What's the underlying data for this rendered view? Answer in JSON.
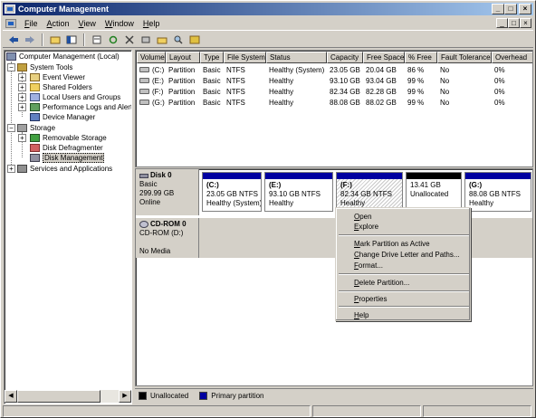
{
  "window": {
    "title": "Computer Management",
    "controls": [
      "_",
      "□",
      "×"
    ]
  },
  "menu": {
    "items": [
      {
        "mnemonic": "F",
        "rest": "ile"
      },
      {
        "mnemonic": "A",
        "rest": "ction"
      },
      {
        "mnemonic": "V",
        "rest": "iew"
      },
      {
        "mnemonic": "W",
        "rest": "indow"
      },
      {
        "mnemonic": "H",
        "rest": "elp"
      }
    ],
    "mdi_controls": [
      "_",
      "□",
      "×"
    ]
  },
  "toolbar": {
    "icons": [
      "back-icon",
      "forward-icon",
      "up-folder-icon",
      "show-hide-tree-icon",
      "properties-icon",
      "refresh-icon",
      "delete-icon",
      "settings-icon",
      "open-icon",
      "search-icon",
      "help-icon"
    ]
  },
  "tree": {
    "root": "Computer Management (Local)",
    "system_tools": "System Tools",
    "event_viewer": "Event Viewer",
    "shared_folders": "Shared Folders",
    "local_users": "Local Users and Groups",
    "perf_logs": "Performance Logs and Alerts",
    "device_manager": "Device Manager",
    "storage": "Storage",
    "removable_storage": "Removable Storage",
    "disk_defrag": "Disk Defragmenter",
    "disk_management": "Disk Management",
    "services_apps": "Services and Applications"
  },
  "volume_list": {
    "headers": [
      "Volume",
      "Layout",
      "Type",
      "File System",
      "Status",
      "Capacity",
      "Free Space",
      "% Free",
      "Fault Tolerance",
      "Overhead"
    ],
    "rows": [
      [
        "(C:)",
        "Partition",
        "Basic",
        "NTFS",
        "Healthy (System)",
        "23.05 GB",
        "20.04 GB",
        "86 %",
        "No",
        "0%"
      ],
      [
        "(E:)",
        "Partition",
        "Basic",
        "NTFS",
        "Healthy",
        "93.10 GB",
        "93.04 GB",
        "99 %",
        "No",
        "0%"
      ],
      [
        "(F:)",
        "Partition",
        "Basic",
        "NTFS",
        "Healthy",
        "82.34 GB",
        "82.28 GB",
        "99 %",
        "No",
        "0%"
      ],
      [
        "(G:)",
        "Partition",
        "Basic",
        "NTFS",
        "Healthy",
        "88.08 GB",
        "88.02 GB",
        "99 %",
        "No",
        "0%"
      ]
    ]
  },
  "disks": {
    "disk0": {
      "name": "Disk 0",
      "type": "Basic",
      "size": "299.99 GB",
      "status": "Online",
      "partitions": [
        {
          "name": "(C:)",
          "detail": "23.05 GB NTFS",
          "status": "Healthy (System)"
        },
        {
          "name": "(E:)",
          "detail": "93.10 GB NTFS",
          "status": "Healthy"
        },
        {
          "name": "(F:)",
          "detail": "82.34 GB NTFS",
          "status": "Healthy"
        },
        {
          "name": "",
          "detail": "13.41 GB",
          "status": "Unallocated"
        },
        {
          "name": "(G:)",
          "detail": "88.08 GB NTFS",
          "status": "Healthy"
        }
      ]
    },
    "cdrom0": {
      "name": "CD-ROM 0",
      "drive": "CD-ROM (D:)",
      "status": "No Media"
    }
  },
  "legend": {
    "unallocated": "Unallocated",
    "primary": "Primary partition",
    "unallocated_color": "#000000",
    "primary_color": "#0000a0"
  },
  "context_menu": {
    "open": {
      "mnemonic": "O",
      "rest": "pen"
    },
    "explore": {
      "mnemonic": "E",
      "rest": "xplore"
    },
    "mark_active": {
      "pre": "",
      "mnemonic": "M",
      "rest": "ark Partition as Active"
    },
    "change_letter": {
      "mnemonic": "C",
      "rest": "hange Drive Letter and Paths..."
    },
    "format": {
      "mnemonic": "F",
      "rest": "ormat..."
    },
    "delete": {
      "mnemonic": "D",
      "rest": "elete Partition..."
    },
    "properties": {
      "mnemonic": "P",
      "rest": "roperties"
    },
    "help": {
      "mnemonic": "H",
      "rest": "elp"
    }
  }
}
